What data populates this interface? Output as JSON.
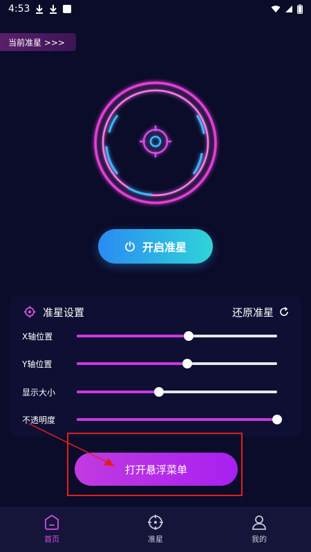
{
  "status_bar": {
    "time": "4:53"
  },
  "crosshair_tag": {
    "label": "当前准星 >>>"
  },
  "power_button": {
    "label": "开启准星"
  },
  "settings": {
    "title": "准星设置",
    "reset_label": "还原准星",
    "sliders": [
      {
        "label": "X轴位置",
        "value": 0.56
      },
      {
        "label": "Y轴位置",
        "value": 0.55
      },
      {
        "label": "显示大小",
        "value": 0.41
      },
      {
        "label": "不透明度",
        "value": 1.0
      }
    ]
  },
  "float_button": {
    "label": "打开悬浮菜单"
  },
  "colors": {
    "accent": "#c93ae0",
    "background": "#0b0b2a",
    "highlight": "#e02020"
  },
  "nav": {
    "items": [
      {
        "label": "首页",
        "icon": "home-icon",
        "active": true
      },
      {
        "label": "准星",
        "icon": "crosshair-icon",
        "active": false
      },
      {
        "label": "我的",
        "icon": "user-icon",
        "active": false
      }
    ]
  }
}
